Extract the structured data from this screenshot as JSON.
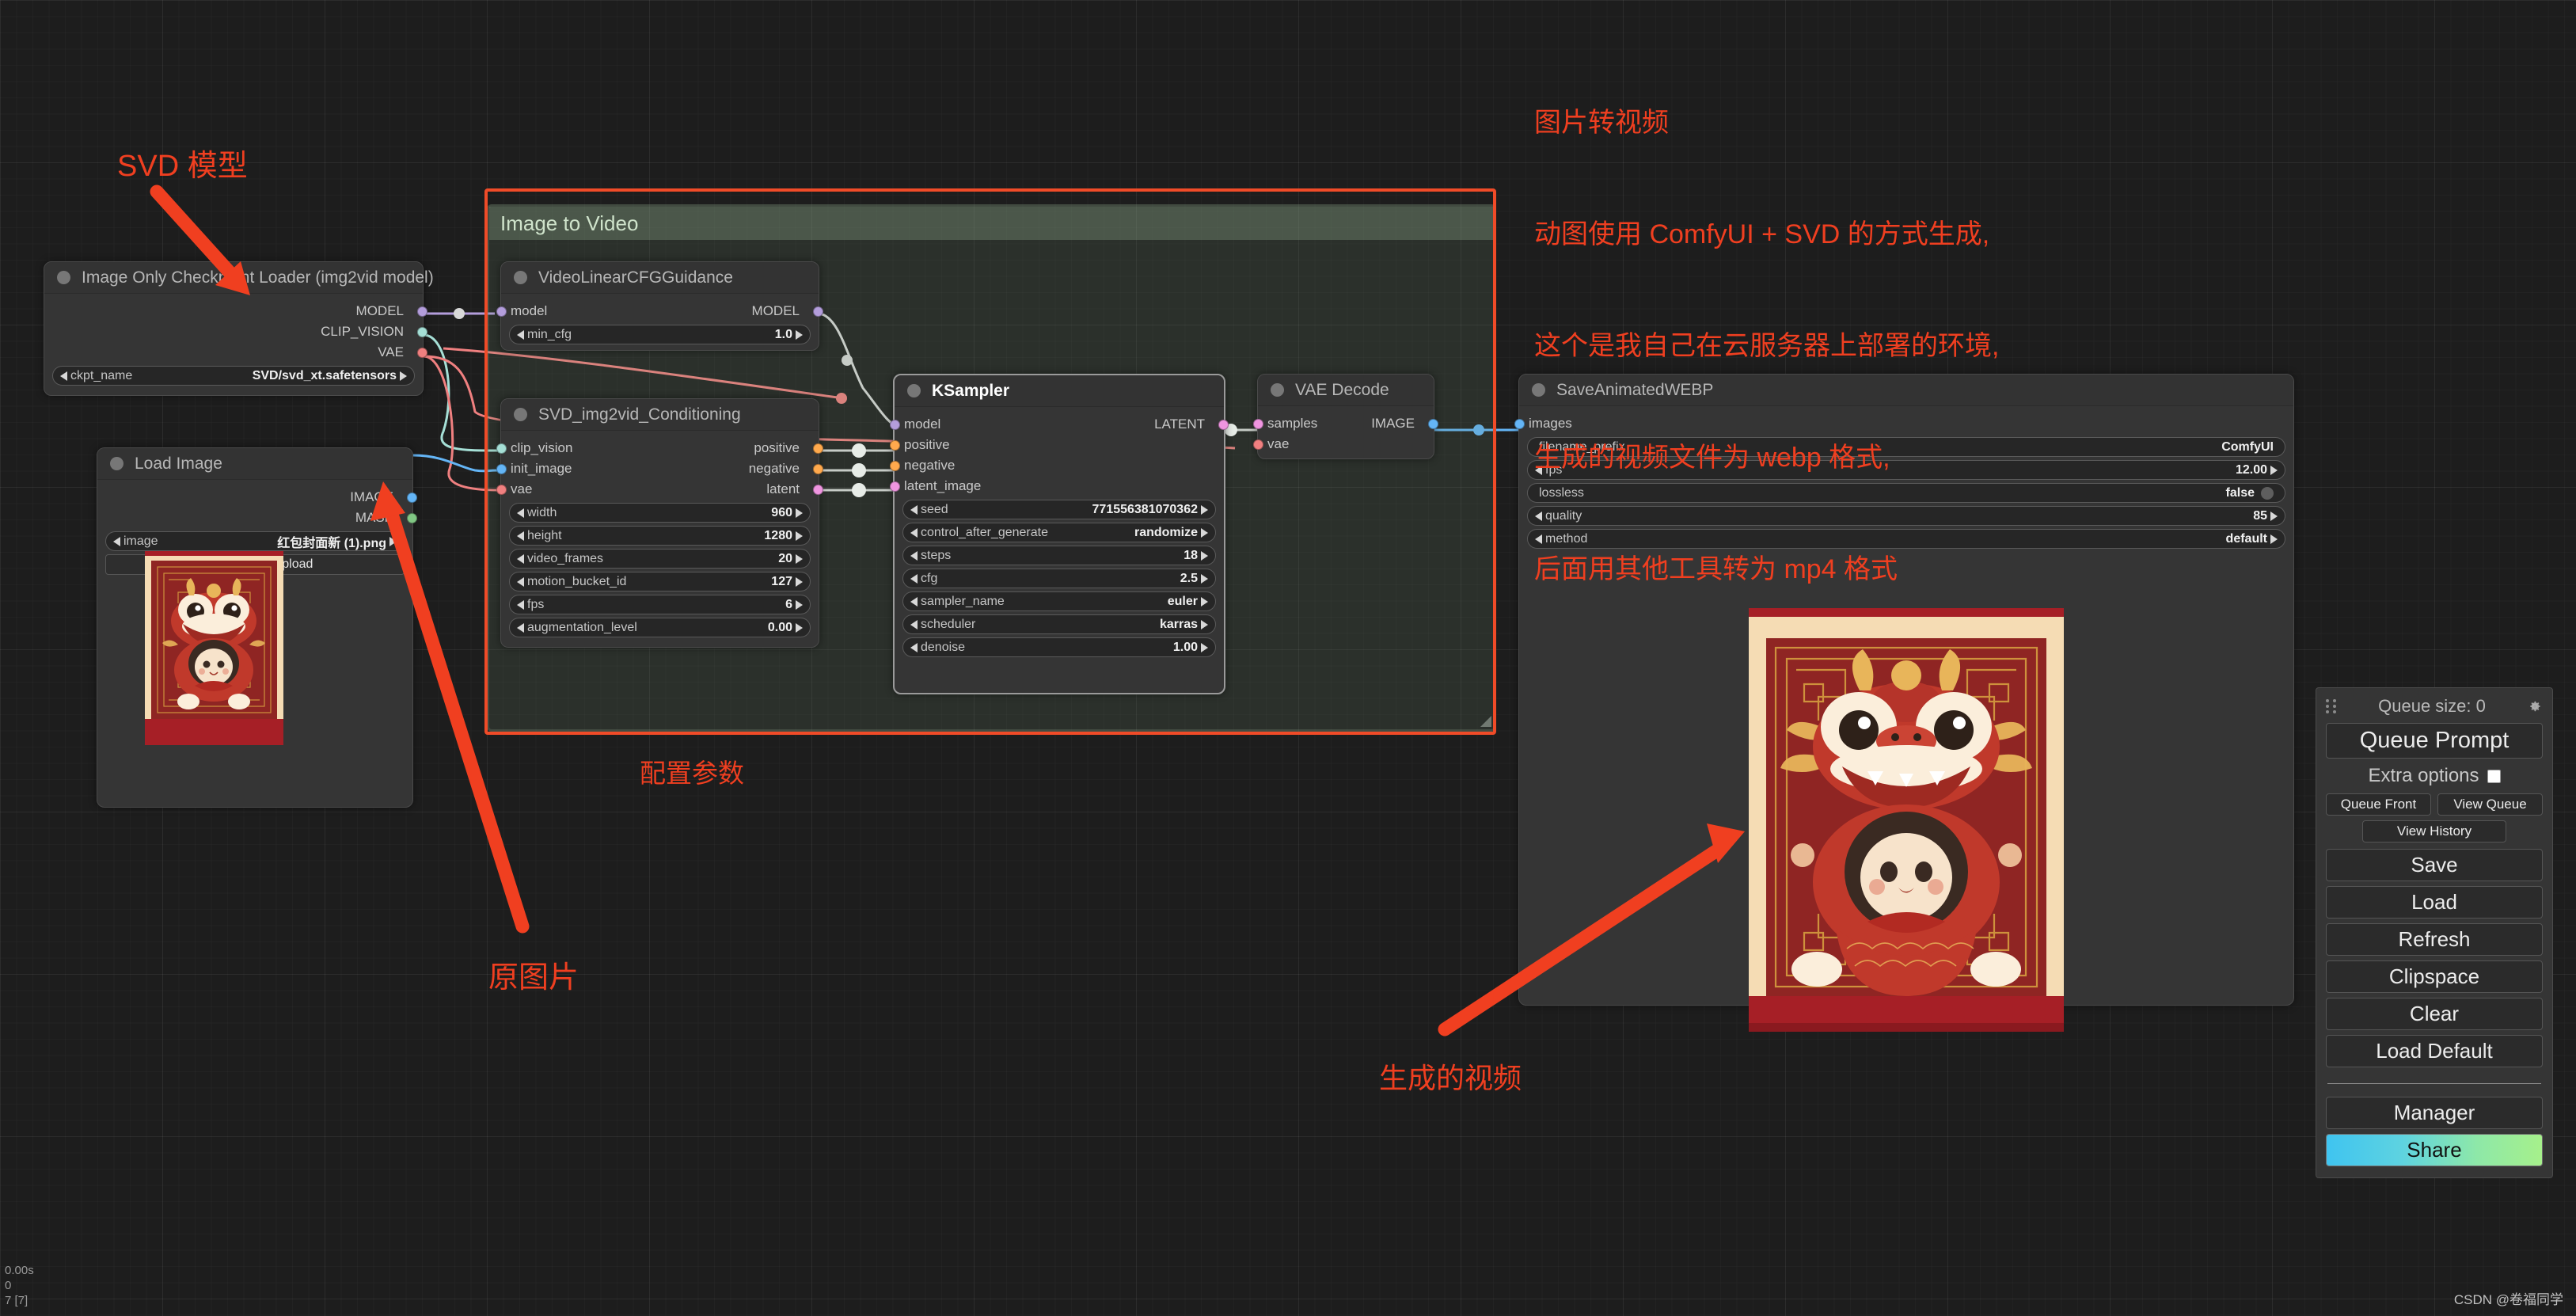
{
  "app": {
    "name": "ComfyUI",
    "watermark": "CSDN @卷福同学"
  },
  "status": {
    "line1": "0.00s",
    "line2": "0",
    "line3": "7 [7]"
  },
  "group": {
    "title": "Image to Video"
  },
  "annotations": {
    "svd_model": "SVD 模型",
    "config_params": "配置参数",
    "source_image": "原图片",
    "generated_video": "生成的视频",
    "note_lines": [
      "图片转视频",
      "动图使用 ComfyUI + SVD 的方式生成,",
      "这个是我自己在云服务器上部署的环境,",
      "生成的视频文件为 webp 格式,",
      "后面用其他工具转为 mp4 格式"
    ]
  },
  "nodes": {
    "checkpoint_loader": {
      "title": "Image Only Checkpoint Loader (img2vid model)",
      "outputs": [
        {
          "label": "MODEL",
          "color": "#b39ddb"
        },
        {
          "label": "CLIP_VISION",
          "color": "#a5dfd6"
        },
        {
          "label": "VAE",
          "color": "#f08080"
        }
      ],
      "widgets": [
        {
          "name": "ckpt_name",
          "value": "SVD/svd_xt.safetensors",
          "arrows": true
        }
      ]
    },
    "load_image": {
      "title": "Load Image",
      "outputs": [
        {
          "label": "IMAGE",
          "color": "#64b5f6"
        },
        {
          "label": "MASK",
          "color": "#81c784"
        }
      ],
      "widgets": [
        {
          "name": "image",
          "value": "红包封面新 (1).png",
          "arrows": true
        }
      ],
      "button": "choose file to upload"
    },
    "video_cfg": {
      "title": "VideoLinearCFGGuidance",
      "inputs": [
        {
          "label": "model",
          "color": "#b39ddb"
        }
      ],
      "outputs": [
        {
          "label": "MODEL",
          "color": "#b39ddb"
        }
      ],
      "widgets": [
        {
          "name": "min_cfg",
          "value": "1.0",
          "arrows": true
        }
      ]
    },
    "svd_conditioning": {
      "title": "SVD_img2vid_Conditioning",
      "inputs": [
        {
          "label": "clip_vision",
          "color": "#a5dfd6"
        },
        {
          "label": "init_image",
          "color": "#64b5f6"
        },
        {
          "label": "vae",
          "color": "#f08080"
        }
      ],
      "outputs": [
        {
          "label": "positive",
          "color": "#ffa94d"
        },
        {
          "label": "negative",
          "color": "#ffa94d"
        },
        {
          "label": "latent",
          "color": "#ef95e0"
        }
      ],
      "widgets": [
        {
          "name": "width",
          "value": "960",
          "arrows": true
        },
        {
          "name": "height",
          "value": "1280",
          "arrows": true
        },
        {
          "name": "video_frames",
          "value": "20",
          "arrows": true
        },
        {
          "name": "motion_bucket_id",
          "value": "127",
          "arrows": true
        },
        {
          "name": "fps",
          "value": "6",
          "arrows": true
        },
        {
          "name": "augmentation_level",
          "value": "0.00",
          "arrows": true
        }
      ]
    },
    "ksampler": {
      "title": "KSampler",
      "inputs": [
        {
          "label": "model",
          "color": "#b39ddb"
        },
        {
          "label": "positive",
          "color": "#ffa94d"
        },
        {
          "label": "negative",
          "color": "#ffa94d"
        },
        {
          "label": "latent_image",
          "color": "#ef95e0"
        }
      ],
      "outputs": [
        {
          "label": "LATENT",
          "color": "#ef95e0"
        }
      ],
      "widgets": [
        {
          "name": "seed",
          "value": "771556381070362",
          "arrows": true
        },
        {
          "name": "control_after_generate",
          "value": "randomize",
          "arrows": true
        },
        {
          "name": "steps",
          "value": "18",
          "arrows": true
        },
        {
          "name": "cfg",
          "value": "2.5",
          "arrows": true
        },
        {
          "name": "sampler_name",
          "value": "euler",
          "arrows": true
        },
        {
          "name": "scheduler",
          "value": "karras",
          "arrows": true
        },
        {
          "name": "denoise",
          "value": "1.00",
          "arrows": true
        }
      ]
    },
    "vae_decode": {
      "title": "VAE Decode",
      "inputs": [
        {
          "label": "samples",
          "color": "#ef95e0"
        },
        {
          "label": "vae",
          "color": "#f08080"
        }
      ],
      "outputs": [
        {
          "label": "IMAGE",
          "color": "#64b5f6"
        }
      ]
    },
    "save_webp": {
      "title": "SaveAnimatedWEBP",
      "inputs": [
        {
          "label": "images",
          "color": "#64b5f6"
        }
      ],
      "widgets": [
        {
          "name": "filename_prefix",
          "value": "ComfyUI",
          "arrows": false
        },
        {
          "name": "fps",
          "value": "12.00",
          "arrows": true
        },
        {
          "name": "lossless",
          "value": "false",
          "arrows": false,
          "toggle": true
        },
        {
          "name": "quality",
          "value": "85",
          "arrows": true
        },
        {
          "name": "method",
          "value": "default",
          "arrows": true
        }
      ]
    }
  },
  "menu": {
    "queue_size_label": "Queue size: 0",
    "queue_prompt": "Queue Prompt",
    "extra_options": "Extra options",
    "queue_front": "Queue Front",
    "view_queue": "View Queue",
    "view_history": "View History",
    "save": "Save",
    "load": "Load",
    "refresh": "Refresh",
    "clipspace": "Clipspace",
    "clear": "Clear",
    "load_default": "Load Default",
    "manager": "Manager",
    "share": "Share"
  },
  "colors": {
    "accent_red": "#f03f20",
    "group_green": "#cfe3cb",
    "share_gradient_start": "#3fc4f0",
    "share_gradient_end": "#a6f08b"
  }
}
